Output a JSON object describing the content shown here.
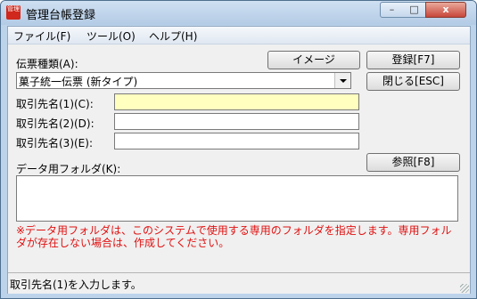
{
  "window": {
    "title": "管理台帳登録",
    "app_icon_text": "管理",
    "controls": {
      "minimize": "–",
      "maximize": "□",
      "close": "x"
    }
  },
  "menu": {
    "items": [
      {
        "label": "ファイル(F)"
      },
      {
        "label": "ツール(O)"
      },
      {
        "label": "ヘルプ(H)"
      }
    ]
  },
  "form": {
    "slip_type_label": "伝票種類(A):",
    "slip_type_value": "菓子統一伝票 (新タイプ)",
    "image_button": "イメージ",
    "register_button": "登録[F7]",
    "close_button": "閉じる[ESC]",
    "partner1_label": "取引先名(1)(C):",
    "partner1_value": "",
    "partner2_label": "取引先名(2)(D):",
    "partner2_value": "",
    "partner3_label": "取引先名(3)(E):",
    "partner3_value": "",
    "data_folder_label": "データ用フォルダ(K):",
    "browse_button": "参照[F8]",
    "data_folder_value": "",
    "note": "※データ用フォルダは、このシステムで使用する専用のフォルダを指定します。専用フォルダが存在しない場合は、作成してください。"
  },
  "status": {
    "text": "取引先名(1)を入力します。"
  },
  "colors": {
    "focused_input": "#ffffc0",
    "note_text": "#e01010",
    "window_frame": "#bcd3ea"
  }
}
